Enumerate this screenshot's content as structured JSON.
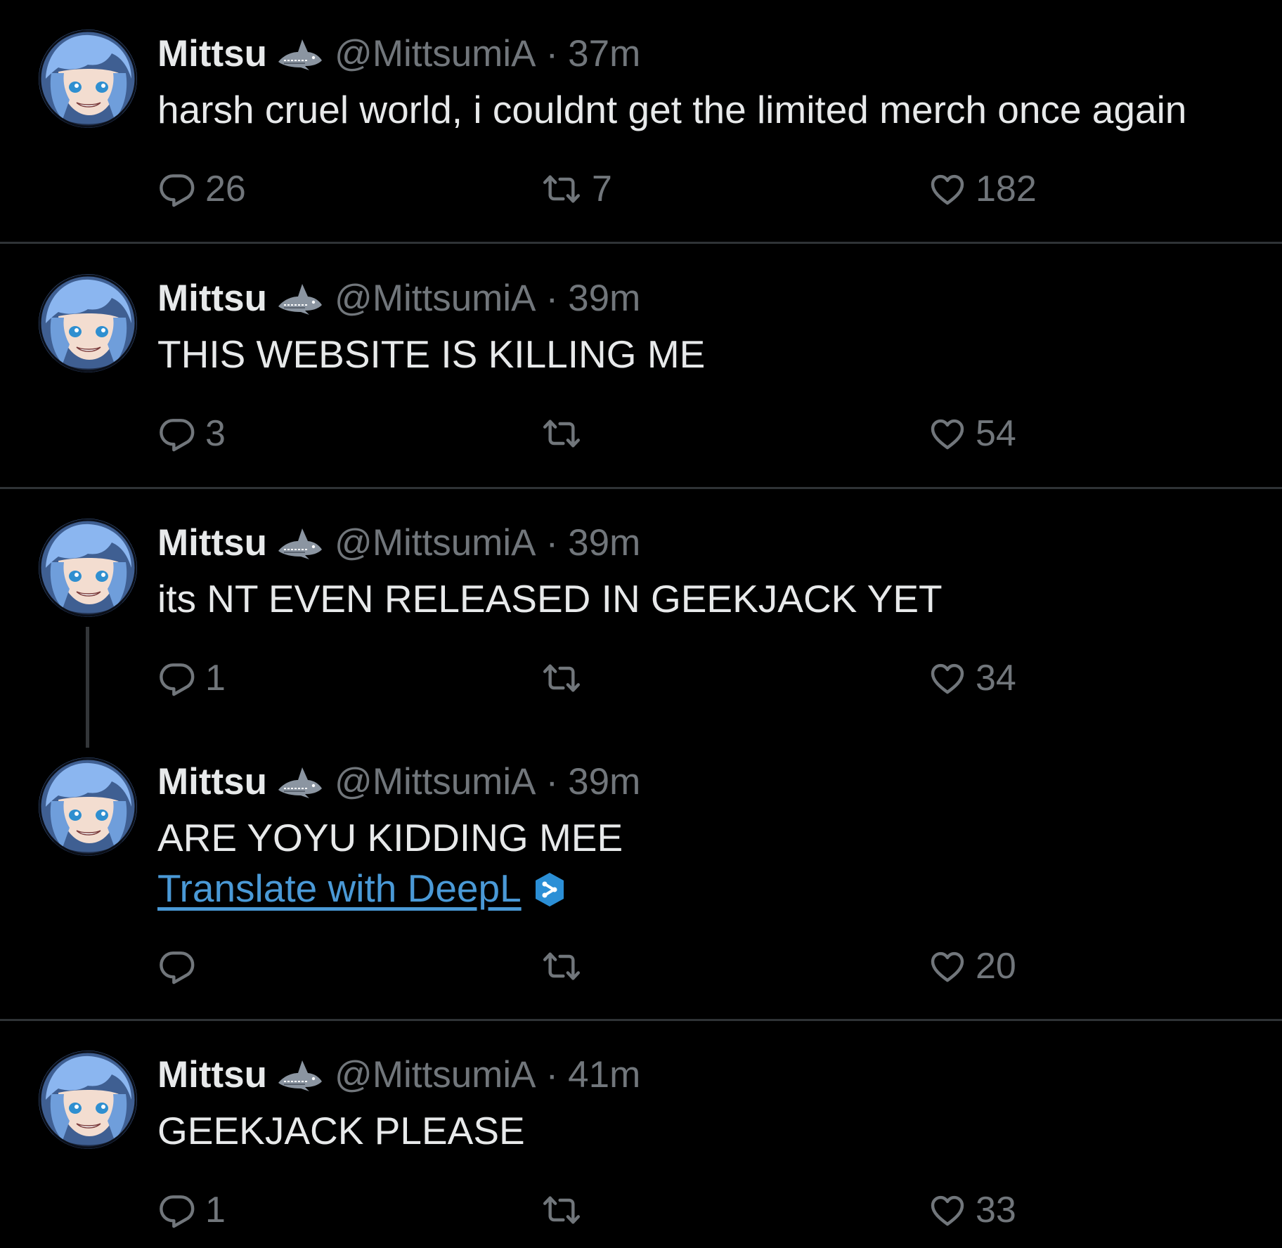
{
  "colors": {
    "background": "#000000",
    "text": "#e7e9ea",
    "muted": "#71767b",
    "divider": "#2f3336",
    "link": "#4a99d6"
  },
  "icons": {
    "reply": "speech-bubble-icon",
    "retweet": "retweet-arrows-icon",
    "like": "heart-outline-icon",
    "badge": "shark-icon",
    "translate": "deepl-icon"
  },
  "tweets": [
    {
      "name": "Mittsu",
      "handle": "@MittsumiA",
      "separator": "·",
      "time": "37m",
      "text": "harsh cruel world, i couldnt get the limited merch once again",
      "replies": "26",
      "retweets": "7",
      "likes": "182"
    },
    {
      "name": "Mittsu",
      "handle": "@MittsumiA",
      "separator": "·",
      "time": "39m",
      "text": "THIS WEBSITE IS KILLING ME",
      "replies": "3",
      "retweets": "",
      "likes": "54"
    },
    {
      "name": "Mittsu",
      "handle": "@MittsumiA",
      "separator": "·",
      "time": "39m",
      "text": "its NT EVEN RELEASED IN GEEKJACK YET",
      "replies": "1",
      "retweets": "",
      "likes": "34"
    },
    {
      "name": "Mittsu",
      "handle": "@MittsumiA",
      "separator": "·",
      "time": "39m",
      "text": "ARE YOYU KIDDING MEE",
      "translate_label": "Translate with DeepL",
      "replies": "",
      "retweets": "",
      "likes": "20"
    },
    {
      "name": "Mittsu",
      "handle": "@MittsumiA",
      "separator": "·",
      "time": "41m",
      "text": "GEEKJACK PLEASE",
      "replies": "1",
      "retweets": "",
      "likes": "33"
    }
  ]
}
